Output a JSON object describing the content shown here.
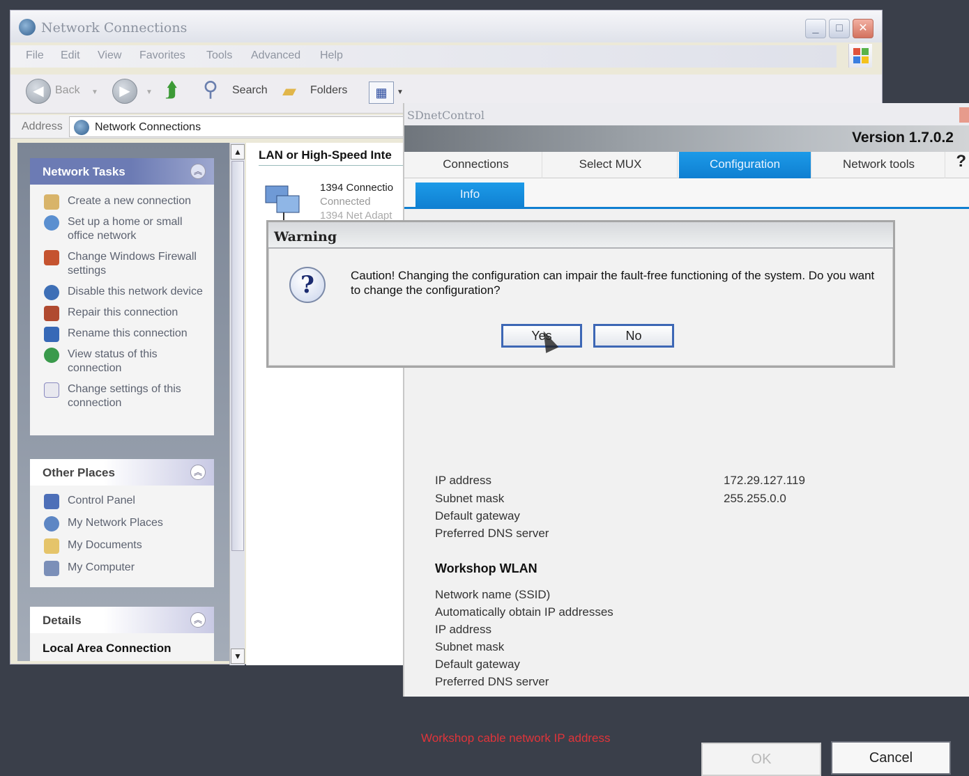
{
  "network_connections": {
    "title": "Network Connections",
    "menu": [
      "File",
      "Edit",
      "View",
      "Favorites",
      "Tools",
      "Advanced",
      "Help"
    ],
    "toolbar": {
      "back": "Back",
      "search": "Search",
      "folders": "Folders"
    },
    "address": {
      "label": "Address",
      "value": "Network Connections"
    },
    "network_tasks": {
      "header": "Network Tasks",
      "items": [
        "Create a new connection",
        "Set up a home or small office network",
        "Change Windows Firewall settings",
        "Disable this network device",
        "Repair this connection",
        "Rename this connection",
        "View status of this connection",
        "Change settings of this connection"
      ]
    },
    "other_places": {
      "header": "Other Places",
      "items": [
        "Control Panel",
        "My Network Places",
        "My Documents",
        "My Computer"
      ]
    },
    "details": {
      "header": "Details",
      "name": "Local Area Connection"
    },
    "content": {
      "group_title": "LAN or High-Speed Inte",
      "connection_name": "1394 Connectio",
      "connection_status": "Connected",
      "connection_adapter": "1394 Net Adapt"
    }
  },
  "sdnet": {
    "title": "SDnetControl",
    "version": "Version 1.7.0.2",
    "tabs": [
      "Connections",
      "Select MUX",
      "Configuration",
      "Network tools"
    ],
    "active_tab": "Configuration",
    "help": "?",
    "subtab": "Info",
    "cable": {
      "labels": [
        "IP address",
        "Subnet mask",
        "Default gateway",
        "Preferred DNS server"
      ],
      "ip_address": "172.29.127.119",
      "subnet_mask": "255.255.0.0"
    },
    "wlan": {
      "title": "Workshop WLAN",
      "labels": [
        "Network name (SSID)",
        "Automatically obtain IP addresses",
        "IP address",
        "Subnet mask",
        "Default gateway",
        "Preferred DNS server"
      ]
    },
    "warning_text": "Workshop cable network IP address",
    "ok": "OK",
    "cancel": "Cancel"
  },
  "warning_dialog": {
    "title": "Warning",
    "message": "Caution! Changing the configuration can impair the fault-free functioning of the system. Do you want to change the configuration?",
    "yes": "Yes",
    "no": "No"
  }
}
